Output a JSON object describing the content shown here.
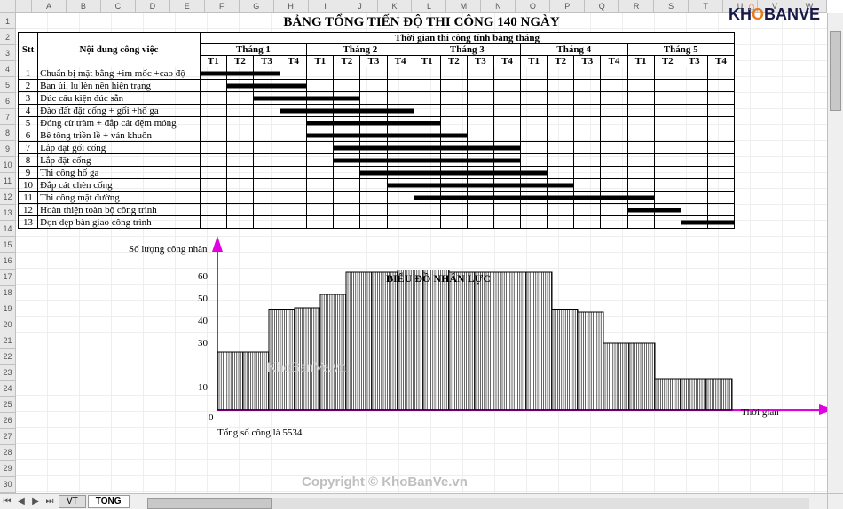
{
  "spreadsheet": {
    "columns": [
      "",
      "A",
      "B",
      "C",
      "D",
      "E",
      "F",
      "G",
      "H",
      "I",
      "J",
      "K",
      "L",
      "M",
      "N",
      "O",
      "P",
      "Q",
      "R",
      "S",
      "T",
      "U",
      "V",
      "W"
    ],
    "rows": [
      "1",
      "2",
      "3",
      "4",
      "5",
      "6",
      "7",
      "8",
      "9",
      "10",
      "11",
      "12",
      "13",
      "14",
      "15",
      "16",
      "17",
      "18",
      "19",
      "20",
      "21",
      "22",
      "23",
      "24",
      "25",
      "26",
      "27",
      "28",
      "29",
      "30"
    ],
    "tabs": [
      "VT",
      "TONG"
    ],
    "active_tab": "TONG"
  },
  "title": "BẢNG TỔNG TIẾN ĐỘ THI CÔNG 140 NGÀY",
  "header": {
    "stt": "Stt",
    "name": "Nội dung công việc",
    "time_group": "Thời gian thi công tính bằng tháng",
    "months": [
      "Tháng 1",
      "Tháng 2",
      "Tháng 3",
      "Tháng 4",
      "Tháng 5"
    ],
    "weeks": [
      "T1",
      "T2",
      "T3",
      "T4"
    ]
  },
  "tasks": [
    {
      "n": 1,
      "name": "Chuẩn bị mặt bằng +im mốc +cao độ",
      "start": 0,
      "end": 3
    },
    {
      "n": 2,
      "name": "Ban ủi, lu lèn nền hiện trạng",
      "start": 1,
      "end": 4
    },
    {
      "n": 3,
      "name": "Đúc cấu kiện đúc sẵn",
      "start": 2,
      "end": 6
    },
    {
      "n": 4,
      "name": "Đào đất đặt cống + gối +hố ga",
      "start": 3,
      "end": 8
    },
    {
      "n": 5,
      "name": "Đóng cừ tràm + đắp cát đệm móng",
      "start": 4,
      "end": 9
    },
    {
      "n": 6,
      "name": "Bê tông triền lề + ván khuôn",
      "start": 4,
      "end": 10
    },
    {
      "n": 7,
      "name": "Lắp đặt gối cống",
      "start": 5,
      "end": 12
    },
    {
      "n": 8,
      "name": "Lắp đặt cống",
      "start": 5,
      "end": 12
    },
    {
      "n": 9,
      "name": "Thi công hố ga",
      "start": 6,
      "end": 13
    },
    {
      "n": 10,
      "name": "Đắp cát chèn cống",
      "start": 7,
      "end": 14
    },
    {
      "n": 11,
      "name": "Thi công mặt đường",
      "start": 8,
      "end": 17
    },
    {
      "n": 12,
      "name": "Hoàn thiện toàn bộ công trình",
      "start": 16,
      "end": 18
    },
    {
      "n": 13,
      "name": "Dọn dẹp bàn giao công trình",
      "start": 18,
      "end": 20
    }
  ],
  "chart_data": {
    "type": "bar",
    "title": "BIỂU ĐỒ NHÂN LỰC",
    "ylabel": "Số lượng công nhân",
    "xlabel": "Thời gian",
    "ylim": [
      0,
      70
    ],
    "yticks": [
      10,
      30,
      40,
      50,
      60
    ],
    "origin_label": "0",
    "x": [
      1,
      2,
      3,
      4,
      5,
      6,
      7,
      8,
      9,
      10,
      11,
      12,
      13,
      14,
      15,
      16,
      17,
      18,
      19,
      20
    ],
    "values": [
      26,
      26,
      45,
      46,
      52,
      62,
      62,
      63,
      63,
      62,
      62,
      62,
      62,
      45,
      44,
      30,
      30,
      14,
      14,
      14
    ],
    "footer": "Tổng số công là 5534"
  },
  "logo": {
    "pre": "KH",
    "o": "O",
    "post": "BANVE",
    "roof": "⌂"
  },
  "watermark1": "KhoBanVe.vn",
  "watermark2": "Copyright © KhoBanVe.vn"
}
